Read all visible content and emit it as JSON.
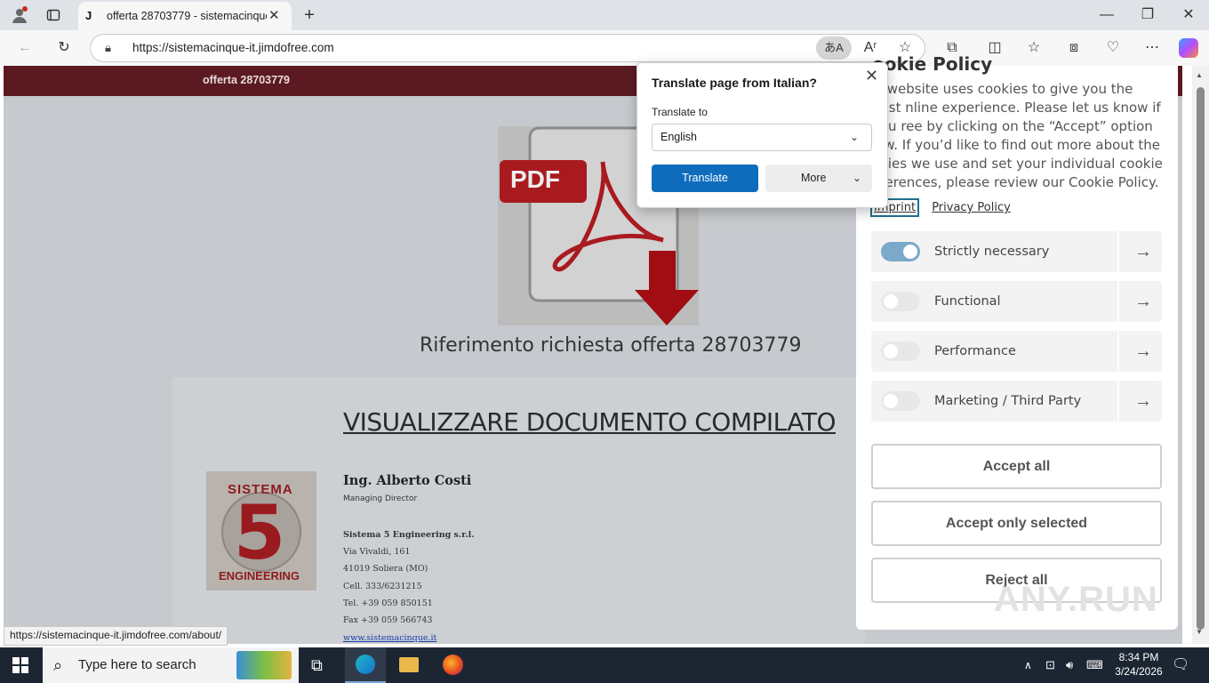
{
  "browser": {
    "tab_title": "offerta 28703779 - sistemacinque",
    "tab_favicon": "J",
    "url": "https://sistemacinque-it.jimdofree.com",
    "translate_pill": "あA",
    "status_url": "https://sistemacinque-it.jimdofree.com/about/"
  },
  "site": {
    "bar_title": "offerta 28703779",
    "pdf_label": "PDF",
    "reference_title": "Riferimento richiesta offerta 28703779",
    "doc_heading": "VISUALIZZARE DOCUMENTO COMPILATO",
    "contact": {
      "name": "Ing. Alberto Costi",
      "role": "Managing Director",
      "company": "Sistema 5 Engineering s.r.l.",
      "address1": "Via Vivaldi, 161",
      "address2": "41019  Soliera (MO)",
      "cell": "Cell. 333/6231215",
      "tel": "Tel. +39 059 850151",
      "fax": "Fax +39 059 566743",
      "web": "www.sistemacinque.it"
    },
    "logo_top": "SISTEMA",
    "logo_number": "5",
    "logo_bottom": "ENGINEERING"
  },
  "cookie": {
    "heading_partial": "ookie Policy",
    "text": "is website uses cookies to give you the best nline experience. Please let us know if you ree by clicking on the “Accept” option low. If you’d like to find out more about the okies we use and set your individual cookie eferences, please review our Cookie Policy.",
    "link_imprint": "Imprint",
    "link_privacy": "Privacy Policy",
    "categories": [
      {
        "label": "Strictly necessary",
        "enabled": true
      },
      {
        "label": "Functional",
        "enabled": false
      },
      {
        "label": "Performance",
        "enabled": false
      },
      {
        "label": "Marketing / Third Party",
        "enabled": false
      }
    ],
    "btn_accept_all": "Accept all",
    "btn_accept_selected": "Accept only selected",
    "btn_reject_all": "Reject all",
    "watermark": "ANY.RUN"
  },
  "translate_popup": {
    "title": "Translate page from Italian?",
    "label": "Translate to",
    "selected_language": "English",
    "translate_button": "Translate",
    "more_button": "More"
  },
  "taskbar": {
    "search_placeholder": "Type here to search",
    "time": "8:34 PM",
    "date": "3/24/2026"
  },
  "colors": {
    "site_bar": "#5b1a22",
    "translate_blue": "#0f6cbd",
    "toggle_on": "#7aa9c9",
    "taskbar": "#1c2633"
  }
}
